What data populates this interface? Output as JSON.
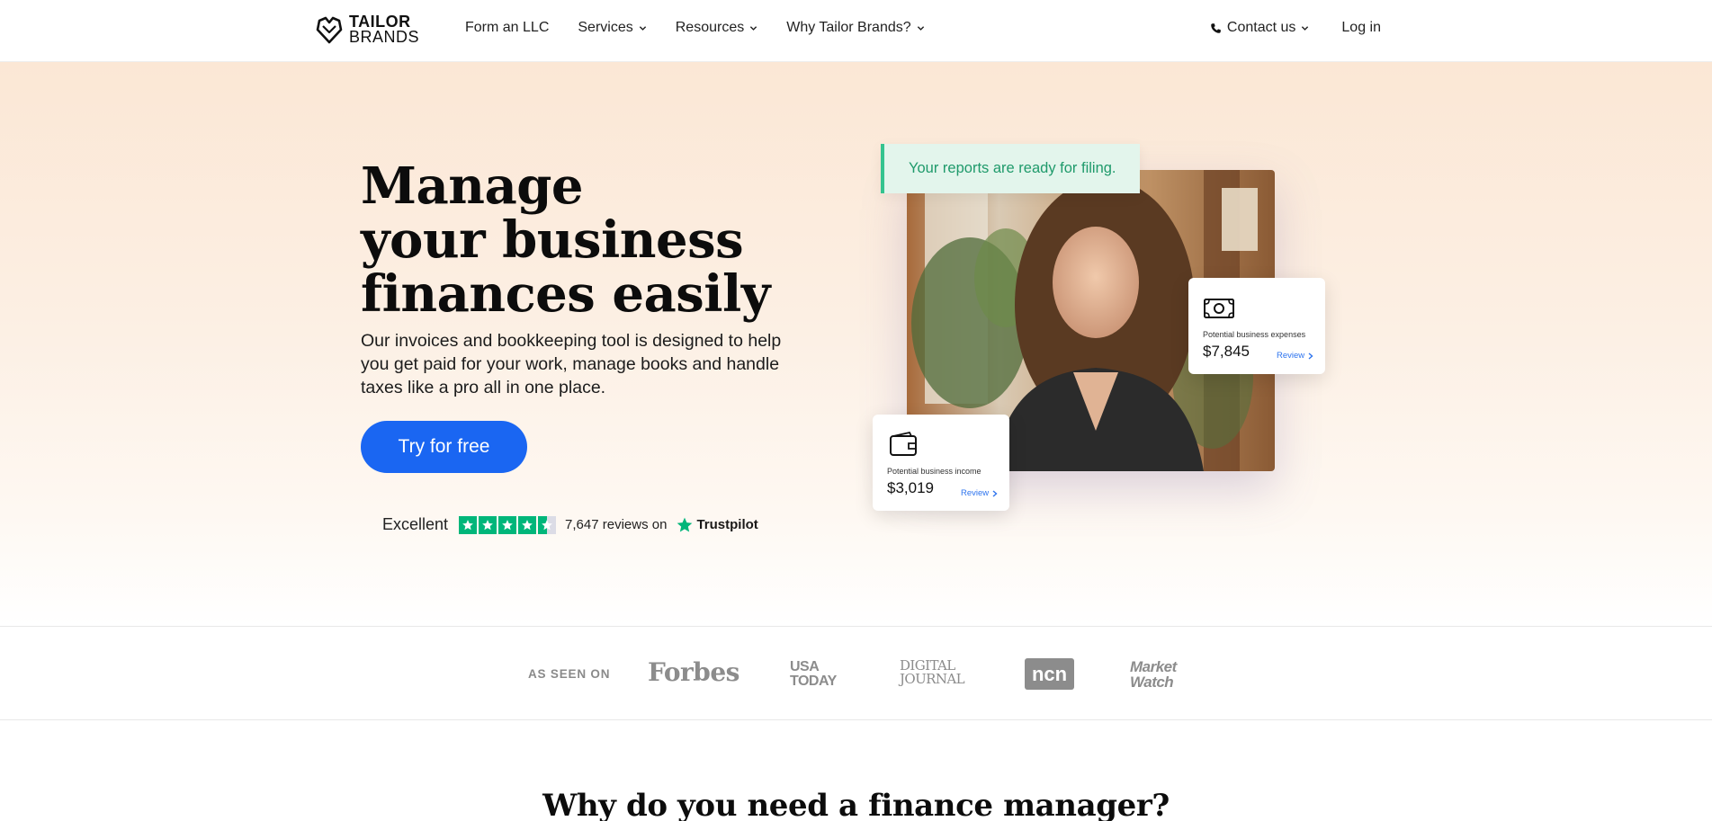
{
  "nav": {
    "logo_line1": "TAILOR",
    "logo_line2": "BRANDS",
    "links": [
      {
        "label": "Form an LLC",
        "dropdown": false
      },
      {
        "label": "Services",
        "dropdown": true
      },
      {
        "label": "Resources",
        "dropdown": true
      },
      {
        "label": "Why Tailor Brands?",
        "dropdown": true
      }
    ],
    "contact_label": "Contact us",
    "login_label": "Log in"
  },
  "hero": {
    "headline": "Manage\nyour business\nfinances easily",
    "description": "Our invoices and bookkeeping tool is designed to help you get paid for your work, manage books and handle taxes like a pro all in one place.",
    "cta_label": "Try for free",
    "trustpilot": {
      "rating_text": "Excellent",
      "reviews_text": "7,647 reviews on",
      "brand": "Trustpilot",
      "stars": 4.5
    }
  },
  "visual": {
    "notification": "Your reports are ready for filing.",
    "expenses": {
      "label": "Potential business expenses",
      "amount": "$7,845",
      "action": "Review"
    },
    "income": {
      "label": "Potential business income",
      "amount": "$3,019",
      "action": "Review"
    }
  },
  "press": {
    "label": "AS SEEN ON",
    "logos": {
      "forbes": "Forbes",
      "usatoday_1": "USA",
      "usatoday_2": "TODAY",
      "digital_1": "DIGITAL",
      "digital_2": "JOURNAL",
      "ncn": "ncn",
      "mw_1": "Market",
      "mw_2": "Watch"
    }
  },
  "section": {
    "title": "Why do you need a finance manager?"
  },
  "colors": {
    "accent": "#1a66f2",
    "trustpilot_green": "#00b67a",
    "notification_bg": "#e3f5ec",
    "notification_text": "#1f9a6b"
  }
}
